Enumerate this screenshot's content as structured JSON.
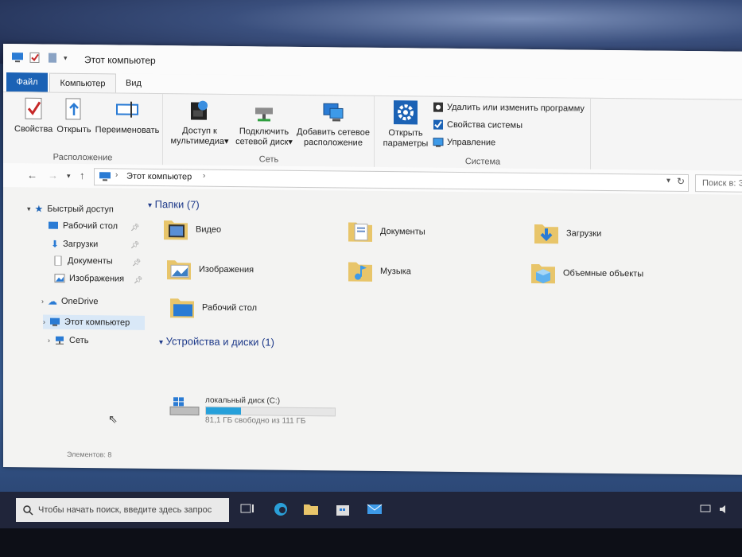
{
  "window": {
    "title": "Этот компьютер"
  },
  "tabs": [
    {
      "label": "Файл"
    },
    {
      "label": "Компьютер"
    },
    {
      "label": "Вид"
    }
  ],
  "ribbon": {
    "location": {
      "label": "Расположение",
      "buttons": [
        "Свойства",
        "Открыть",
        "Переименовать"
      ]
    },
    "network": {
      "label": "Сеть",
      "media_line1": "Доступ к",
      "media_line2": "мультимедиа",
      "map_line1": "Подключить",
      "map_line2": "сетевой диск",
      "add_line1": "Добавить сетевое",
      "add_line2": "расположение"
    },
    "system": {
      "label": "Система",
      "open_line1": "Открыть",
      "open_line2": "параметры",
      "uninstall": "Удалить или изменить программу",
      "properties": "Свойства системы",
      "manage": "Управление"
    }
  },
  "address": {
    "path": "Этот компьютер",
    "search_placeholder": "Поиск в: Э"
  },
  "sidebar": {
    "quick_access": "Быстрый доступ",
    "items": [
      "Рабочий стол",
      "Загрузки",
      "Документы",
      "Изображения"
    ],
    "onedrive": "OneDrive",
    "this_pc": "Этот компьютер",
    "network": "Сеть"
  },
  "folders_section": "Папки (7)",
  "folders": [
    "Видео",
    "Документы",
    "Загрузки",
    "Изображения",
    "Музыка",
    "Объемные объекты",
    "Рабочий стол"
  ],
  "devices_section": "Устройства и диски (1)",
  "drive": {
    "name": "локальный диск (C:)",
    "free_text": "81,1 ГБ свободно из 111 ГБ",
    "used_fraction": 0.27
  },
  "status": "Элементов: 8",
  "taskbar": {
    "search_placeholder": "Чтобы начать поиск, введите здесь запрос"
  },
  "colors": {
    "accent": "#1b62b5",
    "drive_fill": "#26a0da",
    "section_text": "#1e3a8a"
  }
}
